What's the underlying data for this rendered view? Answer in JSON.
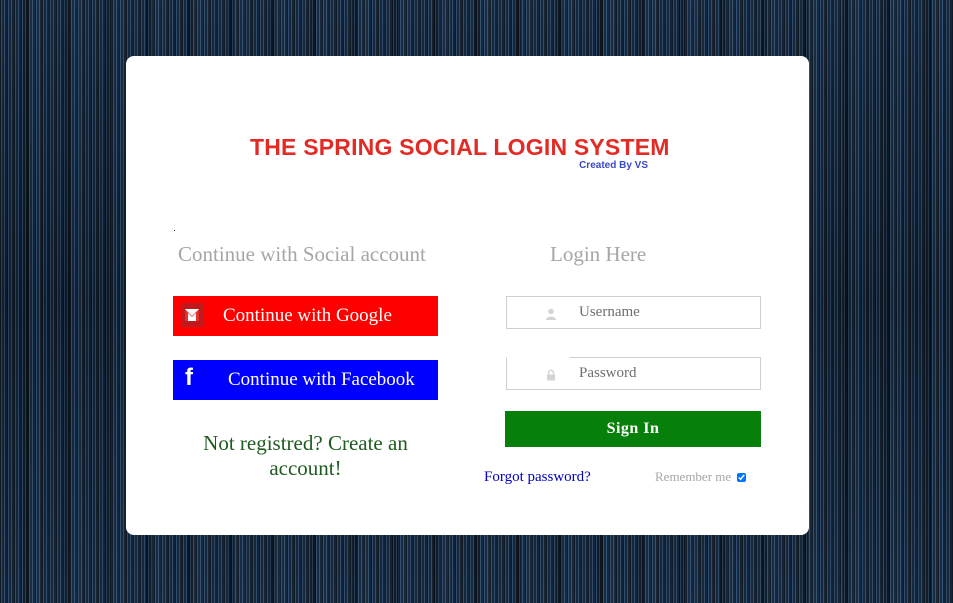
{
  "brand": {
    "title": "THE SPRING SOCIAL LOGIN SYSTEM",
    "subtitle": "Created By VS",
    "title_color": "#e32b26",
    "subtitle_color": "#3a48c4"
  },
  "social": {
    "heading": "Continue with Social account",
    "google_label": "Continue with Google",
    "google_color": "#ff0000",
    "google_icon": "gmail-icon",
    "facebook_label": "Continue with Facebook",
    "facebook_color": "#0000ff",
    "facebook_icon": "facebook-icon",
    "register_text": "Not registred? Create an account!"
  },
  "login": {
    "heading": "Login Here",
    "username_placeholder": "Username",
    "username_value": "",
    "username_icon": "user-icon",
    "password_placeholder": "Password",
    "password_value": "",
    "password_icon": "lock-icon",
    "signin_label": "Sign In",
    "signin_color": "#06800a",
    "forgot_label": "Forgot password?",
    "remember_label": "Remember me",
    "remember_checked": true
  }
}
